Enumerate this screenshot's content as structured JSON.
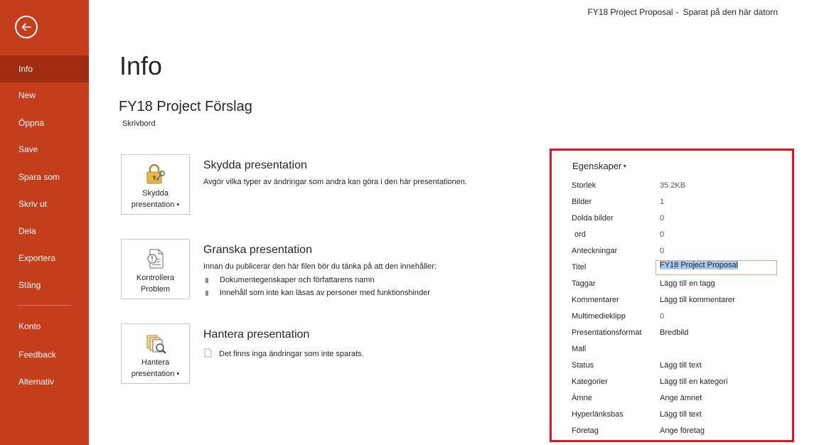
{
  "topbar": {
    "doc_title": "FY18 Project Proposal",
    "separator": "-",
    "save_status": "Sparat på den här datorn"
  },
  "sidebar": {
    "items": [
      {
        "label": "Info"
      },
      {
        "label": "New"
      },
      {
        "label": "Öppna"
      },
      {
        "label": "Save"
      },
      {
        "label": "Spara som"
      },
      {
        "label": "Skriv ut"
      },
      {
        "label": "Dela"
      },
      {
        "label": "Exportera"
      },
      {
        "label": "Stäng"
      },
      {
        "label": "Konto"
      },
      {
        "label": "Feedback"
      },
      {
        "label": "Alternativ"
      }
    ],
    "accent": "#c43e1c",
    "active": "#a02d12"
  },
  "main": {
    "title": "Info",
    "doc_name": "FY18 Project Förslag",
    "doc_location": "Skrivbord",
    "sections": [
      {
        "tile_label": "Skydda presentation •",
        "tile_icon": "lock-key-icon",
        "title": "Skydda presentation",
        "desc": "Avgör vilka typer av ändringar som andra kan göra i den här presentationen."
      },
      {
        "tile_label": "Kontrollera Problem",
        "tile_icon": "inspect-document-icon",
        "title": "Granska presentation",
        "desc": "Innan du publicerar den här filen bör du tänka på att den innehåller:",
        "bullets": [
          "Dokumentegenskaper och författarens namn",
          "Innehåll som inte kan läsas av personer med funktionshinder"
        ]
      },
      {
        "tile_label": "Hantera presentation •",
        "tile_icon": "manage-presentation-icon",
        "title": "Hantera presentation",
        "desc": "Det finns inga ändringar som inte sparats."
      }
    ]
  },
  "properties": {
    "header": "Egenskaper",
    "rows": [
      {
        "label": "Storlek",
        "value": "35.2KB"
      },
      {
        "label": "Bilder",
        "value": "1"
      },
      {
        "label": "Dolda bilder",
        "value": "0"
      },
      {
        "label": "ord",
        "value": "0"
      },
      {
        "label": "Anteckningar",
        "value": "0"
      },
      {
        "label": "Titel",
        "value": "FY18 Project Proposal"
      },
      {
        "label": "Taggar",
        "value": "Lägg till en tagg"
      },
      {
        "label": "Kommentarer",
        "value": "Lägg till kommentarer"
      },
      {
        "label": "Multimedieklipp",
        "value": "0"
      },
      {
        "label": "Presentationsformat",
        "value": "Bredbild"
      },
      {
        "label": "Mall",
        "value": ""
      },
      {
        "label": "Status",
        "value": "Lägg till text"
      },
      {
        "label": "Kategorier",
        "value": "Lägg till en kategori"
      },
      {
        "label": "Ämne",
        "value": "Ange ämnet"
      },
      {
        "label": "Hyperlänksbas",
        "value": "Lägg till text"
      },
      {
        "label": "Företag",
        "value": "Ange företag"
      }
    ],
    "highlight_color": "#e81123"
  }
}
